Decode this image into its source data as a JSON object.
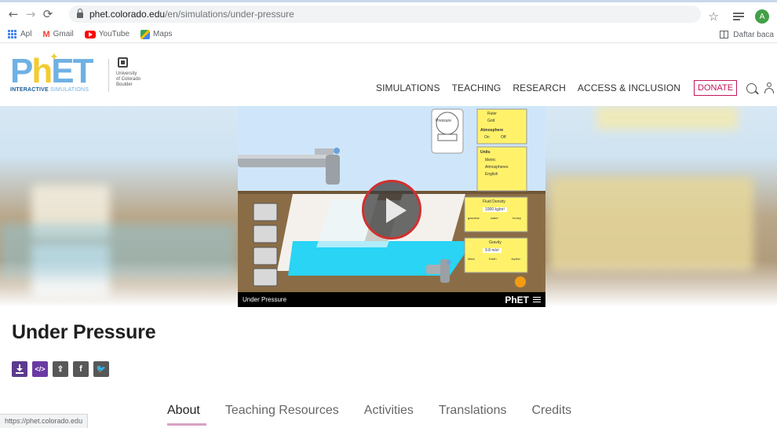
{
  "browser": {
    "url_host": "phet.colorado.edu",
    "url_path": "/en/simulations/under-pressure",
    "profile_initial": "A",
    "bookmarks": [
      "Apl",
      "Gmail",
      "YouTube",
      "Maps"
    ],
    "reading_list": "Daftar baca",
    "status_url": "https://phet.colorado.edu"
  },
  "header": {
    "logo_text": "PhET",
    "logo_sub_bold": "INTERACTIVE",
    "logo_sub": "SIMULATIONS",
    "partner_lines": [
      "University",
      "of Colorado",
      "Boulder"
    ],
    "nav": [
      "SIMULATIONS",
      "TEACHING",
      "RESEARCH",
      "ACCESS & INCLUSION"
    ],
    "donate_label": "DONATE"
  },
  "sim": {
    "title": "Under Pressure",
    "brand": "PhET",
    "panels": {
      "pressure_gauge": "Pressure",
      "ruler": "Ruler",
      "grid": "Grid",
      "atmosphere": "Atmosphere",
      "atm_on": "On",
      "atm_off": "Off",
      "units": "Units",
      "units_options": [
        "Metric",
        "Atmospheres",
        "English"
      ],
      "fluid_density": "Fluid Density",
      "fluid_density_value": "1000 kg/m³",
      "fluid_scale": [
        "gasoline",
        "water",
        "honey"
      ],
      "gravity": "Gravity",
      "gravity_value": "9.8 m/s²",
      "gravity_scale": [
        "Mars",
        "Earth",
        "Jupiter"
      ]
    }
  },
  "page": {
    "title": "Under Pressure",
    "tabs": [
      "About",
      "Teaching Resources",
      "Activities",
      "Translations",
      "Credits"
    ],
    "active_tab": "About"
  }
}
